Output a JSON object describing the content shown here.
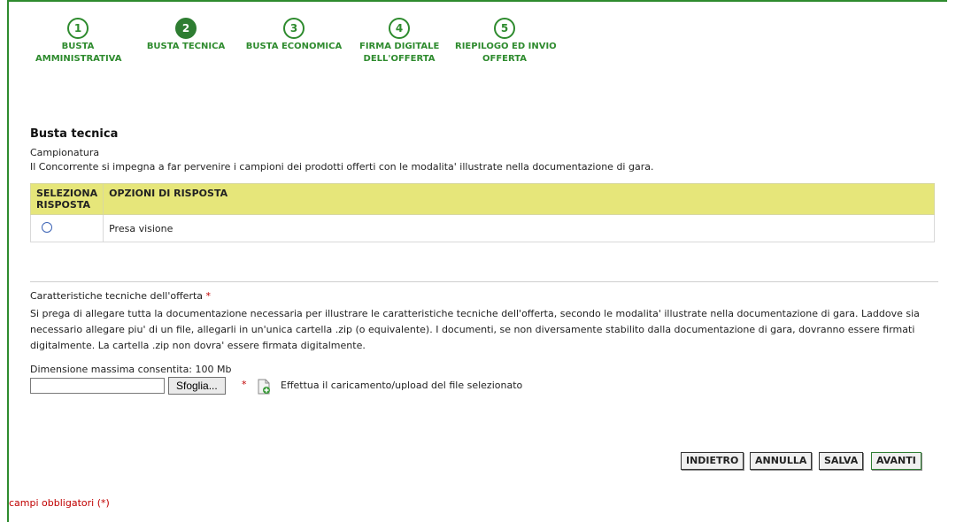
{
  "steps": [
    {
      "number": "1",
      "label_lines": [
        "BUSTA",
        "AMMINISTRATIVA"
      ],
      "active": false
    },
    {
      "number": "2",
      "label_lines": [
        "BUSTA TECNICA"
      ],
      "active": true
    },
    {
      "number": "3",
      "label_lines": [
        "BUSTA ECONOMICA"
      ],
      "active": false
    },
    {
      "number": "4",
      "label_lines": [
        "FIRMA DIGITALE",
        "DELL'OFFERTA"
      ],
      "active": false
    },
    {
      "number": "5",
      "label_lines": [
        "RIEPILOGO ED INVIO",
        "OFFERTA"
      ],
      "active": false
    }
  ],
  "section": {
    "title": "Busta tecnica",
    "subtitle": "Campionatura",
    "description": "Il Concorrente si impegna a far pervenire i campioni dei prodotti offerti con le modalita' illustrate nella documentazione di gara."
  },
  "options_table": {
    "col1_line1": "SELEZIONA",
    "col1_line2": "RISPOSTA",
    "col2": "OPZIONI DI RISPOSTA",
    "rows": [
      {
        "label": "Presa visione",
        "selected": false
      }
    ]
  },
  "tech": {
    "label": "Caratteristiche tecniche dell'offerta",
    "required_mark": "*",
    "long_text": "Si prega di allegare tutta la documentazione necessaria per illustrare le caratteristiche tecniche dell'offerta, secondo le modalita' illustrate nella documentazione di gara. Laddove sia necessario allegare piu' di un file, allegarli in un'unica cartella .zip (o equivalente). I documenti, se non diversamente stabilito dalla documentazione di gara, dovranno essere firmati digitalmente. La cartella .zip non dovra' essere firmata digitalmente.",
    "max_size": "Dimensione massima consentita: 100 Mb",
    "browse_label": "Sfoglia...",
    "file_value": "",
    "upload_text": "Effettua il caricamento/upload del file selezionato",
    "upload_icon": "document-add-icon"
  },
  "buttons": {
    "back": "INDIETRO",
    "cancel": "ANNULLA",
    "save": "SALVA",
    "next": "AVANTI"
  },
  "footer": {
    "required_note": "campi obbligatori (*)"
  },
  "colors": {
    "accent": "#2e8b2e",
    "header_bg": "#e6e67a",
    "required": "#c00000"
  }
}
